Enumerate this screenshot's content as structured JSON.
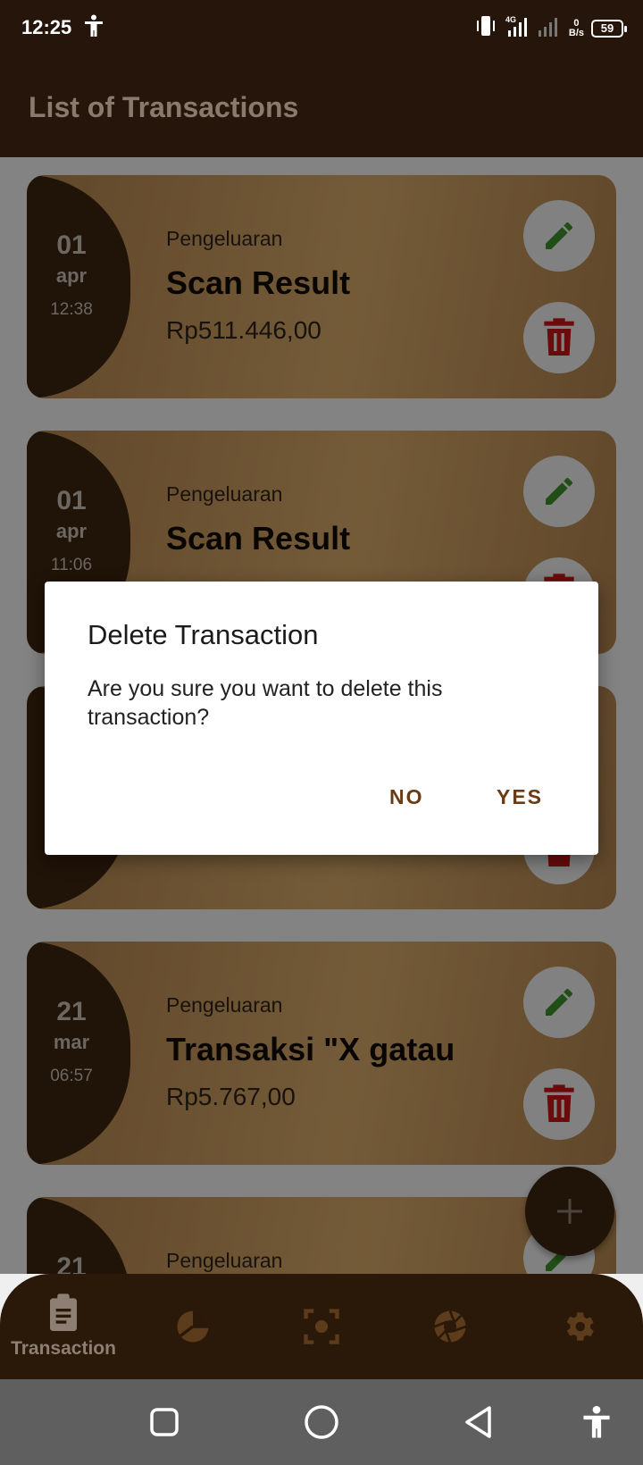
{
  "status_bar": {
    "time": "12:25",
    "net_speed_value": "0",
    "net_speed_unit": "B/s",
    "network_type": "4G",
    "battery": "59"
  },
  "app_bar": {
    "title": "List of Transactions"
  },
  "transactions": [
    {
      "day": "01",
      "month": "apr",
      "time": "12:38",
      "type": "Pengeluaran",
      "title": "Scan Result",
      "amount": "Rp511.446,00"
    },
    {
      "day": "01",
      "month": "apr",
      "time": "11:06",
      "type": "Pengeluaran",
      "title": "Scan Result",
      "amount": ""
    },
    {
      "day": "",
      "month": "",
      "time": "",
      "type": "",
      "title": "",
      "amount": ""
    },
    {
      "day": "21",
      "month": "mar",
      "time": "06:57",
      "type": "Pengeluaran",
      "title": "Transaksi \"X gatau",
      "amount": "Rp5.767,00"
    },
    {
      "day": "21",
      "month": "",
      "time": "",
      "type": "Pengeluaran",
      "title": "",
      "amount": ""
    }
  ],
  "bottom_nav": {
    "items": [
      {
        "label": "Transaction",
        "icon": "clipboard-icon",
        "active": true
      },
      {
        "label": "",
        "icon": "pie-chart-icon",
        "active": false
      },
      {
        "label": "",
        "icon": "scan-icon",
        "active": false
      },
      {
        "label": "",
        "icon": "camera-shutter-icon",
        "active": false
      },
      {
        "label": "",
        "icon": "gear-icon",
        "active": false
      }
    ]
  },
  "dialog": {
    "title": "Delete Transaction",
    "message": "Are you sure you want to delete this transaction?",
    "no_label": "NO",
    "yes_label": "YES"
  },
  "colors": {
    "app_bar": "#25150a",
    "card_gradient_start": "#b0824e",
    "card_gradient_mid": "#d3a667",
    "date_block": "#3b2410",
    "edit_icon": "#3d8f2a",
    "delete_icon": "#c41414",
    "dialog_button": "#6b3b14"
  }
}
